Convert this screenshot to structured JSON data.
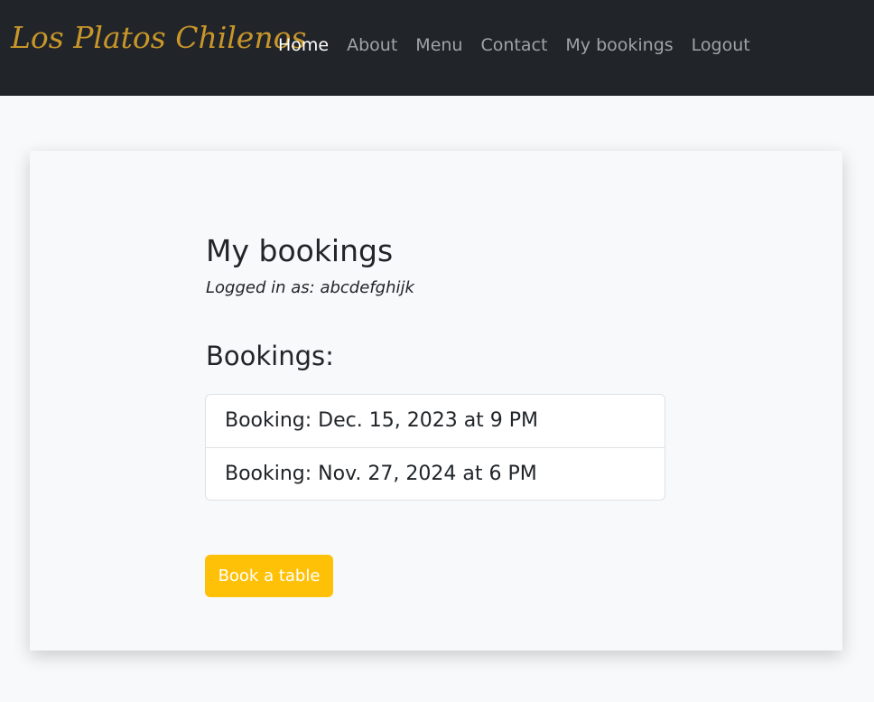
{
  "brand": "Los Platos Chilenos",
  "nav": {
    "items": [
      {
        "label": "Home",
        "active": true
      },
      {
        "label": "About"
      },
      {
        "label": "Menu"
      },
      {
        "label": "Contact"
      },
      {
        "label": "My bookings"
      },
      {
        "label": "Logout"
      }
    ]
  },
  "page": {
    "title": "My bookings",
    "logged_in_prefix": "Logged in as: ",
    "username": "abcdefghijk",
    "bookings_heading": "Bookings:",
    "bookings": [
      "Booking: Dec. 15, 2023 at 9 PM",
      "Booking: Nov. 27, 2024 at 6 PM"
    ],
    "book_button": "Book a table"
  },
  "colors": {
    "navbar_bg": "#212529",
    "brand": "#c8962a",
    "nav_inactive": "#a0a3a7",
    "nav_active": "#ffffff",
    "button_bg": "#ffc107",
    "page_bg": "#f8f9fa"
  }
}
